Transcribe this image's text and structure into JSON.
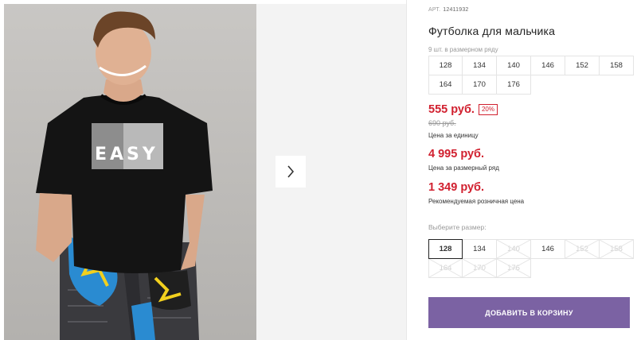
{
  "product": {
    "article_label": "АРТ.",
    "article": "12411932",
    "title": "Футболка для мальчика",
    "sizes_count": "9 шт. в размерном ряду",
    "size_range": [
      "128",
      "134",
      "140",
      "146",
      "152",
      "158",
      "164",
      "170",
      "176"
    ]
  },
  "gallery": {
    "next_icon": "chevron-right-icon",
    "shirt_print": "EASY"
  },
  "pricing": {
    "price": "555 руб.",
    "discount": "20%",
    "old_price": "690 руб.",
    "unit_label": "Цена за единицу",
    "range_price": "4 995 руб.",
    "range_label": "Цена за размерный ряд",
    "retail_price": "1 349 руб.",
    "retail_label": "Рекомендуемая розничная цена",
    "accent_color": "#d1202f"
  },
  "size_picker": {
    "label": "Выберите размер:",
    "selected": "128",
    "options": [
      {
        "size": "128",
        "available": true
      },
      {
        "size": "134",
        "available": true
      },
      {
        "size": "140",
        "available": false
      },
      {
        "size": "146",
        "available": true
      },
      {
        "size": "152",
        "available": false
      },
      {
        "size": "158",
        "available": false
      },
      {
        "size": "164",
        "available": false
      },
      {
        "size": "170",
        "available": false
      },
      {
        "size": "176",
        "available": false
      }
    ]
  },
  "cart": {
    "button_label": "ДОБАВИТЬ В КОРЗИНУ",
    "button_color": "#7b62a3"
  }
}
